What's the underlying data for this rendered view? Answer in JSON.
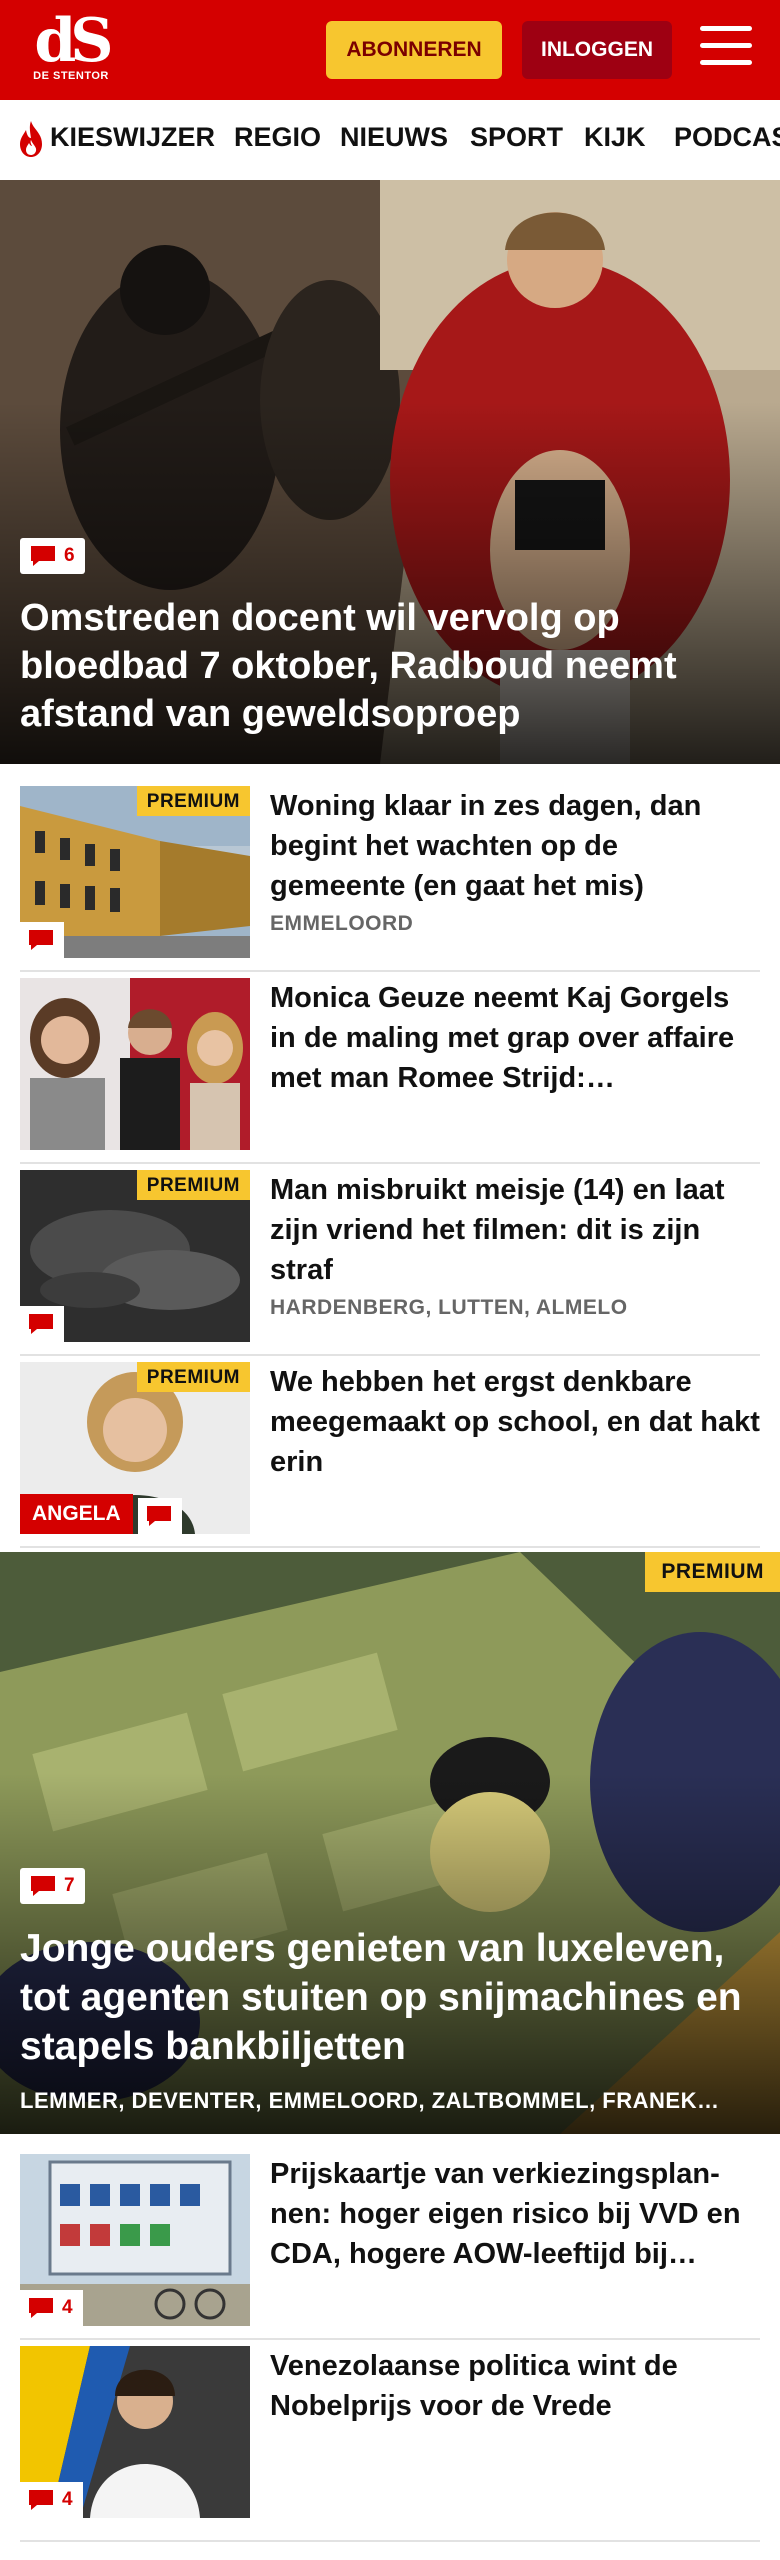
{
  "header": {
    "logo_mark": "dS",
    "logo_sub": "DE STENTOR",
    "subscribe_label": "ABONNEREN",
    "login_label": "INLOGGEN"
  },
  "nav": {
    "items": [
      "KIESWIJZER",
      "REGIO",
      "NIEUWS",
      "SPORT",
      "KIJK",
      "PODCAS"
    ]
  },
  "hero": {
    "comment_count": "6",
    "title": "Omstreden docent wil vervolg op bloedbad 7 oktober, Radboud neemt afstand van geweldsoproep"
  },
  "articles": [
    {
      "title": "Woning klaar in zes dagen, dan begint het wachten op de gemeente (en gaat het mis)",
      "location": "EMMELOORD",
      "premium": "PREMIUM",
      "comments": ""
    },
    {
      "title": "Monica Geuze neemt Kaj Gorgels in de maling met grap over affaire met man Romee Strijd:…",
      "location": "",
      "premium": "",
      "comments": ""
    },
    {
      "title": "Man misbruikt meisje (14) en laat zijn vriend het filmen: dit is zijn straf",
      "location": "HARDENBERG, LUTTEN, ALMELO",
      "premium": "PREMIUM",
      "comments": ""
    },
    {
      "title": "We hebben het ergst denkbare meegemaakt op school, en dat hakt erin",
      "location": "",
      "premium": "PREMIUM",
      "comments": "",
      "author_label": "ANGELA"
    }
  ],
  "feature": {
    "premium": "PREMIUM",
    "comment_count": "7",
    "title": "Jonge ouders genieten van luxeleven, tot agenten stuiten op snijmachines en stapels bankbiljetten",
    "locations": "LEMMER, DEVENTER, EMMELOORD, ZALTBOMMEL, FRANEK…"
  },
  "more_articles": [
    {
      "title": "Prijskaartje van verkiezingsplan­nen: hoger eigen risico bij VVD en CDA, hogere AOW-leeftijd bij…",
      "comments": "4"
    },
    {
      "title": "Venezolaanse politica wint de Nobelprijs voor de Vrede",
      "comments": "4"
    }
  ],
  "colors": {
    "brand_red": "#d40000",
    "premium_yellow": "#f7c62f",
    "login_dark": "#9e0012"
  },
  "icons": [
    "flame-icon",
    "comment-icon",
    "menu-icon"
  ]
}
